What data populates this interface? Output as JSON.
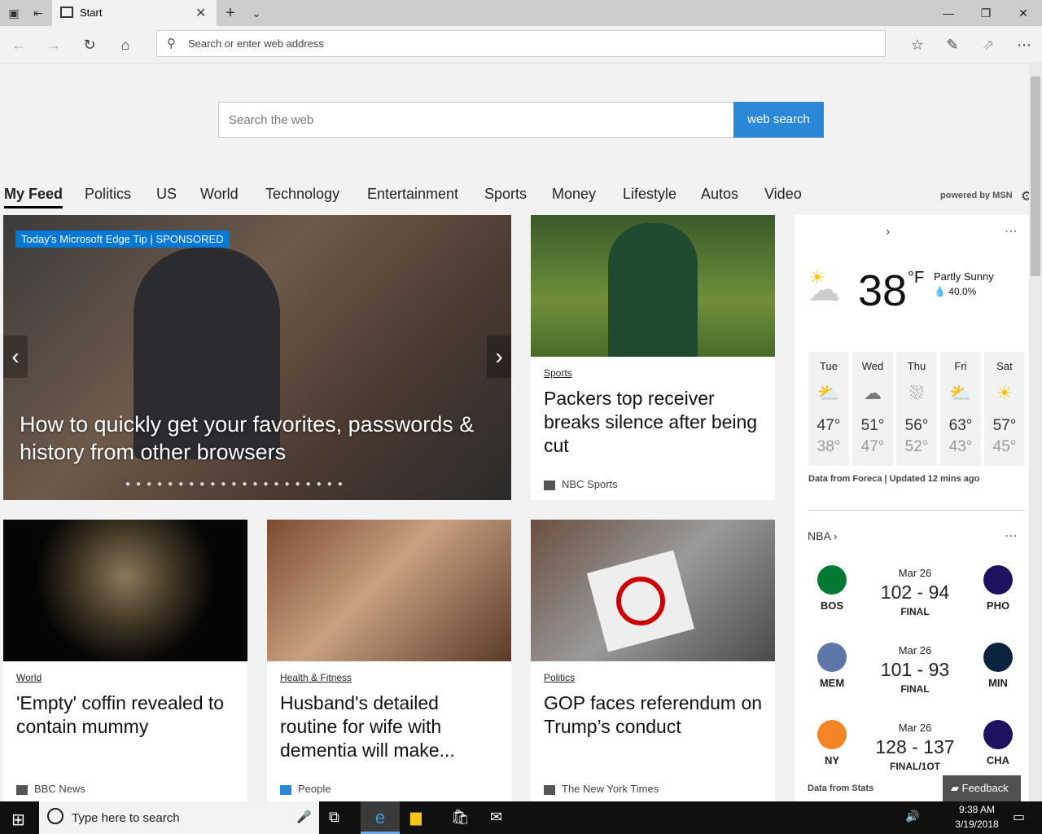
{
  "window": {
    "tab_title": "Start",
    "new_tab_icon": "plus-icon",
    "tab_list_icon": "chevron-down-icon",
    "min_icon": "minimize-icon",
    "restore_icon": "restore-icon",
    "close_icon": "close-icon"
  },
  "nav": {
    "address_placeholder": "Search or enter web address"
  },
  "search": {
    "placeholder": "Search the web",
    "button": "web search"
  },
  "feed": {
    "tabs": [
      "My Feed",
      "Politics",
      "US",
      "World",
      "Technology",
      "Entertainment",
      "Sports",
      "Money",
      "Lifestyle",
      "Autos",
      "Video"
    ],
    "powered_by": "powered by MSN"
  },
  "hero": {
    "badge": "Today's Microsoft Edge Tip | SPONSORED",
    "headline": "How to quickly get your favorites, passwords & history from other browsers"
  },
  "cards": [
    {
      "category": "Sports",
      "headline": "Packers top receiver breaks silence after being cut",
      "source": "NBC Sports"
    },
    {
      "category": "World",
      "headline": "'Empty' coffin revealed to contain mummy",
      "source": "BBC News"
    },
    {
      "category": "Health & Fitness",
      "headline": "Husband's detailed routine for wife with dementia will make...",
      "source": "People"
    },
    {
      "category": "Politics",
      "headline": "GOP faces referendum on Trump’s conduct",
      "source": "The New York Times"
    }
  ],
  "weather": {
    "temp": "38",
    "unit": "°F",
    "condition": "Partly Sunny",
    "precip": "40.0%",
    "days": [
      {
        "name": "Tue",
        "hi": "47°",
        "lo": "38°",
        "icon": "partly-sunny-icon"
      },
      {
        "name": "Wed",
        "hi": "51°",
        "lo": "47°",
        "icon": "cloudy-icon"
      },
      {
        "name": "Thu",
        "hi": "56°",
        "lo": "52°",
        "icon": "rain-icon"
      },
      {
        "name": "Fri",
        "hi": "63°",
        "lo": "43°",
        "icon": "partly-sunny-icon"
      },
      {
        "name": "Sat",
        "hi": "57°",
        "lo": "45°",
        "icon": "sunny-icon"
      }
    ],
    "credit": "Data from Foreca | Updated 12 mins ago"
  },
  "nba": {
    "title": "NBA",
    "games": [
      {
        "date": "Mar 26",
        "score": "102 - 94",
        "status": "FINAL",
        "home": "BOS",
        "away": "PHO",
        "home_color": "#007a33",
        "away_color": "#1d1160"
      },
      {
        "date": "Mar 26",
        "score": "101 - 93",
        "status": "FINAL",
        "home": "MEM",
        "away": "MIN",
        "home_color": "#5d76a9",
        "away_color": "#0c2340"
      },
      {
        "date": "Mar 26",
        "score": "128 - 137",
        "status": "FINAL/1OT",
        "home": "NY",
        "away": "CHA",
        "home_color": "#f58426",
        "away_color": "#1d1160"
      }
    ],
    "credit": "Data from Stats"
  },
  "feedback": "Feedback",
  "taskbar": {
    "search_placeholder": "Type here to search",
    "time": "9:38 AM",
    "date": "3/19/2018"
  }
}
